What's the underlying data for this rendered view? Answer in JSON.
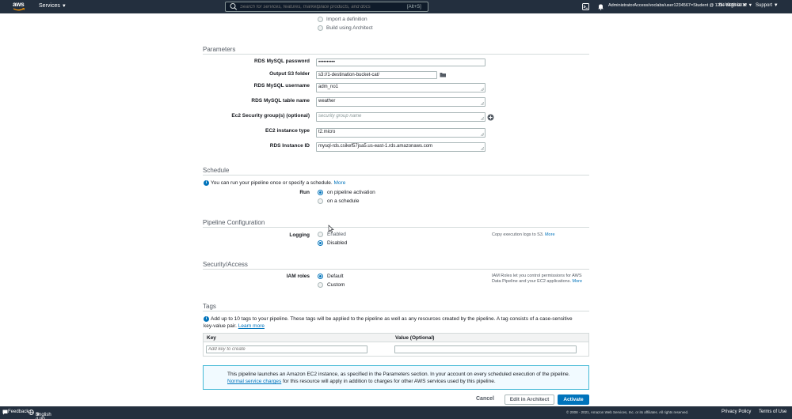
{
  "nav": {
    "logo_text": "aws",
    "services_label": "Services",
    "search_placeholder": "Search for services, features, marketplace products, and docs",
    "search_shortcut": "[Alt+S]",
    "account": "AdministratorAccess/voclabs/user1234567=Student @ 1234-5678-9012",
    "region": "N. Virginia",
    "support": "Support"
  },
  "source": {
    "import_definition": "Import a definition",
    "build_using_architect": "Build using Architect"
  },
  "parameters": {
    "title": "Parameters",
    "rds_password_label": "RDS MySQL password",
    "rds_password_value": "••••••••••",
    "output_s3_label": "Output S3 folder",
    "output_s3_value": "s3://1-destination-bucket-cat/",
    "rds_username_label": "RDS MySQL username",
    "rds_username_value": "adm_no1",
    "rds_table_label": "RDS MySQL table name",
    "rds_table_value": "weather",
    "ec2_sg_label": "Ec2 Security group(s) (optional)",
    "ec2_sg_placeholder": "security group name",
    "ec2_type_label": "EC2 instance type",
    "ec2_type_value": "t2.micro",
    "rds_instance_label": "RDS Instance ID",
    "rds_instance_value": "mysql-rds.csikef57jsa5.us-east-1.rds.amazonaws.com"
  },
  "schedule": {
    "title": "Schedule",
    "info_text": "You can run your pipeline once or specify a schedule.",
    "more_link": "More",
    "run_label": "Run",
    "option_activation": "on pipeline activation",
    "option_schedule": "on a schedule"
  },
  "pipeline_config": {
    "title": "Pipeline Configuration",
    "logging_label": "Logging",
    "option_enabled": "Enabled",
    "option_disabled": "Disabled",
    "help_text": "Copy execution logs to S3.",
    "help_more": "More"
  },
  "security": {
    "title": "Security/Access",
    "iam_label": "IAM roles",
    "option_default": "Default",
    "option_custom": "Custom",
    "help_text_1": "IAM Roles let you control permissions for AWS",
    "help_text_2": "Data Pipeline and your EC2 applications.",
    "help_more": "More"
  },
  "tags": {
    "title": "Tags",
    "info_text_1": "Add up to 10 tags to your pipeline. These tags will be applied to the pipeline as well as any resources created by the pipeline. A tag consists of a case-sensitive",
    "info_text_2": "key-value pair.",
    "learn_more": "Learn more",
    "key_header": "Key",
    "value_header": "Value (Optional)",
    "key_placeholder": "Add key to create"
  },
  "notice": {
    "text_1": "This pipeline launches an Amazon EC2 instance, as specified in the Parameters section. In your account on every scheduled execution of the pipeline.",
    "link": "Normal service charges",
    "text_2": "for this resource will apply in addition to charges for other AWS services used by this pipeline."
  },
  "actions": {
    "cancel": "Cancel",
    "edit_architect": "Edit in Architect",
    "activate": "Activate"
  },
  "footer": {
    "feedback": "Feedback",
    "language": "English (US)",
    "copyright": "© 2008 - 2021, Amazon Web Services, Inc. or its affiliates. All rights reserved.",
    "privacy": "Privacy Policy",
    "terms": "Terms of Use"
  },
  "colors": {
    "nav_bg": "#232f3e",
    "accent_blue": "#0073bb",
    "notice_border": "#44b9d6"
  }
}
